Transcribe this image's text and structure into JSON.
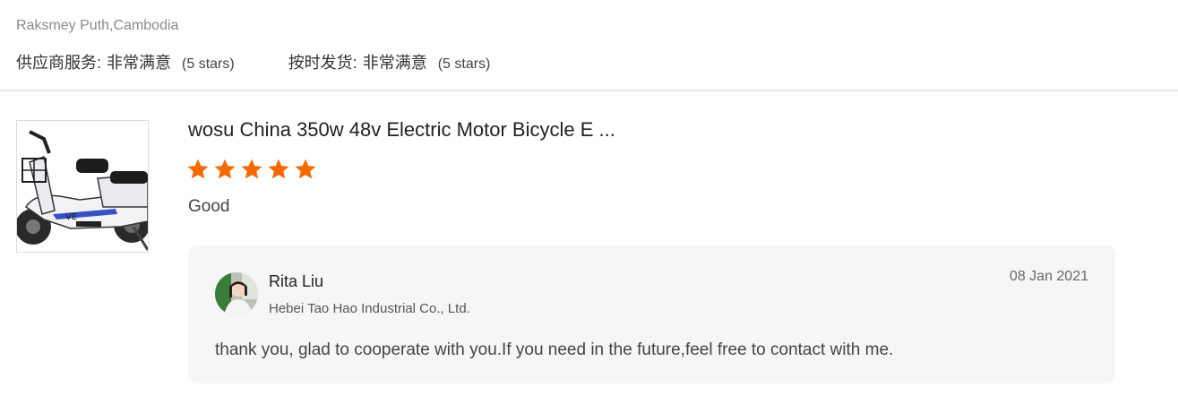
{
  "header": {
    "reviewer": "Raksmey Puth,Cambodia",
    "ratings": [
      {
        "label": "供应商服务:",
        "value": "非常满意",
        "stars": "(5 stars)"
      },
      {
        "label": "按时发货:",
        "value": "非常满意",
        "stars": "(5 stars)"
      }
    ]
  },
  "review": {
    "product_image_icon": "electric-bicycle-image",
    "product_title": "wosu China 350w 48v Electric Motor Bicycle E ...",
    "rating": 5,
    "rating_max": 5,
    "star_color": "#f56a00",
    "text": "Good"
  },
  "reply": {
    "name": "Rita Liu",
    "company": "Hebei Tao Hao Industrial Co., Ltd.",
    "date": "08 Jan 2021",
    "text": "thank you, glad to cooperate with you.If you need in the future,feel free to contact with me."
  }
}
